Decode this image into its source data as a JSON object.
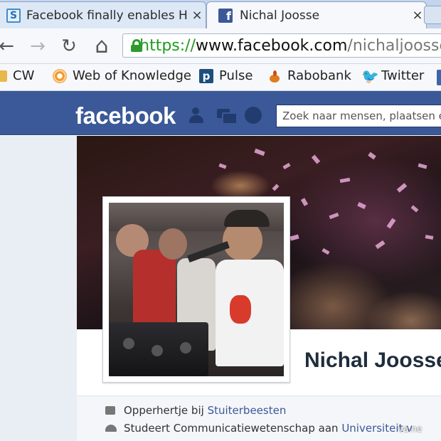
{
  "browser": {
    "tabs": [
      {
        "title": "Facebook finally enables H",
        "favicon": "s-icon"
      },
      {
        "title": "Nichal Joosse",
        "favicon": "facebook-f-icon"
      }
    ],
    "tab_close": "×",
    "url": {
      "scheme": "https://",
      "host": "www.facebook.com",
      "path": "/nichaljoosse"
    },
    "nav": {
      "back": "←",
      "forward": "→",
      "reload": "↻",
      "home": "⌂"
    }
  },
  "bookmarks": [
    "CW",
    "Web of Knowledge",
    "Pulse",
    "Rabobank",
    "Twitter"
  ],
  "facebook": {
    "logo": "facebook",
    "search_placeholder": "Zoek naar mensen, plaatsen e",
    "profile": {
      "name": "Nichal Joosse",
      "work": {
        "prefix": "Opperhertje bij ",
        "link": "Stuiterbeesten"
      },
      "study": {
        "prefix": "Studeert Communicatiewetenschap aan ",
        "link": "Universiteit v"
      }
    }
  },
  "watermark": "va.ne",
  "colors": {
    "fb_blue": "#3b5998",
    "secure_green": "#1f9b1f",
    "link": "#3b5998"
  }
}
